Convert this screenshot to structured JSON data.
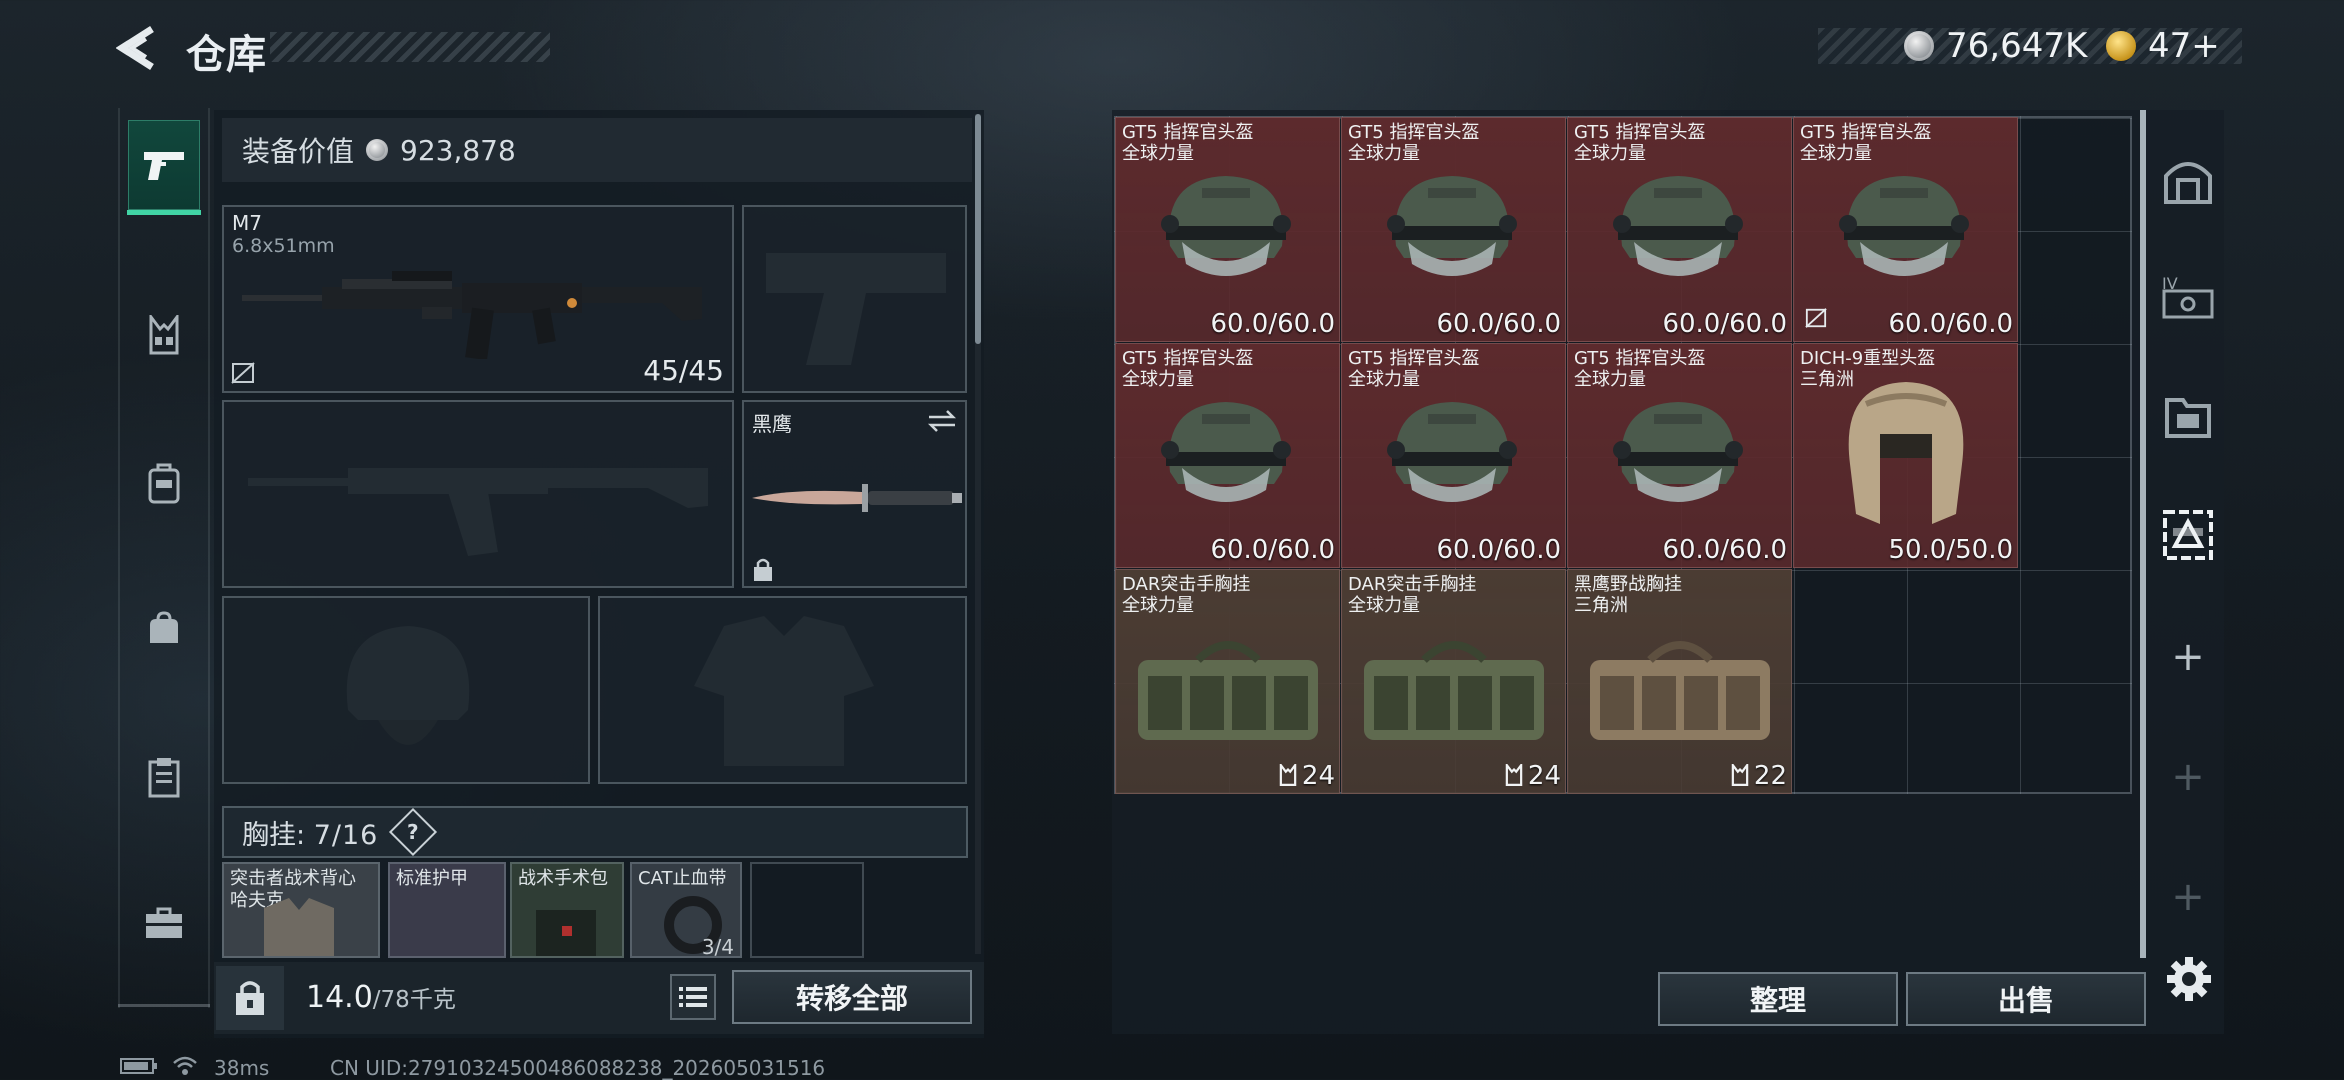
{
  "header": {
    "title": "仓库",
    "currencies": [
      {
        "icon": "silver-coin-icon",
        "value": "76,647K"
      },
      {
        "icon": "gold-coin-icon",
        "value": "47+"
      }
    ]
  },
  "rail_tabs": [
    {
      "name": "weapons",
      "icon": "pistol-icon",
      "active": true
    },
    {
      "name": "chest-rig",
      "icon": "chest-rig-icon",
      "active": false
    },
    {
      "name": "backpack",
      "icon": "backpack-icon",
      "active": false
    },
    {
      "name": "pouch",
      "icon": "pouch-icon",
      "active": false
    },
    {
      "name": "supplies",
      "icon": "clipboard-icon",
      "active": false
    },
    {
      "name": "case",
      "icon": "briefcase-icon",
      "active": false
    }
  ],
  "loadout": {
    "equipment_value_label": "装备价值",
    "equipment_value": "923,878",
    "primary": {
      "name": "M7",
      "caliber": "6.8x51mm",
      "ammo": "45/45"
    },
    "melee": {
      "name": "黑鹰"
    },
    "rig": {
      "label": "胸挂:",
      "count": "7/16",
      "help": "?"
    },
    "rig_items": [
      {
        "name": "突击者战术背心",
        "sub": "哈夫克"
      },
      {
        "name": "标准护甲",
        "sub": ""
      },
      {
        "name": "战术手术包",
        "sub": ""
      },
      {
        "name": "CAT止血带",
        "sub": ""
      }
    ],
    "rig_item_count": "3/4"
  },
  "footer_left": {
    "weight_value": "14.0",
    "weight_max": "/78千克",
    "transfer_all_label": "转移全部"
  },
  "stash": {
    "items": [
      {
        "name": "GT5 指挥官头盔",
        "sub": "全球力量",
        "value": "60.0/60.0",
        "color": "#5c2a2d",
        "kind": "helmet",
        "locked": false
      },
      {
        "name": "GT5 指挥官头盔",
        "sub": "全球力量",
        "value": "60.0/60.0",
        "color": "#5c2a2d",
        "kind": "helmet",
        "locked": false
      },
      {
        "name": "GT5 指挥官头盔",
        "sub": "全球力量",
        "value": "60.0/60.0",
        "color": "#5c2a2d",
        "kind": "helmet",
        "locked": false
      },
      {
        "name": "GT5 指挥官头盔",
        "sub": "全球力量",
        "value": "60.0/60.0",
        "color": "#5c2a2d",
        "kind": "helmet",
        "locked": true
      },
      {
        "name": "GT5 指挥官头盔",
        "sub": "全球力量",
        "value": "60.0/60.0",
        "color": "#5c2a2d",
        "kind": "helmet",
        "locked": false
      },
      {
        "name": "GT5 指挥官头盔",
        "sub": "全球力量",
        "value": "60.0/60.0",
        "color": "#5c2a2d",
        "kind": "helmet",
        "locked": false
      },
      {
        "name": "GT5 指挥官头盔",
        "sub": "全球力量",
        "value": "60.0/60.0",
        "color": "#5c2a2d",
        "kind": "helmet",
        "locked": false
      },
      {
        "name": "DICH-9重型头盔",
        "sub": "三角洲",
        "value": "50.0/50.0",
        "color": "#5c2a2d",
        "kind": "heavy-helmet",
        "locked": false
      },
      {
        "name": "DAR突击手胸挂",
        "sub": "全球力量",
        "value": "24",
        "color": "#4b3c33",
        "kind": "rig",
        "locked": false
      },
      {
        "name": "DAR突击手胸挂",
        "sub": "全球力量",
        "value": "24",
        "color": "#4b3c33",
        "kind": "rig",
        "locked": false
      },
      {
        "name": "黑鹰野战胸挂",
        "sub": "三角洲",
        "value": "22",
        "color": "#4b3c33",
        "kind": "rig-tan",
        "locked": false
      }
    ],
    "sort_label": "整理",
    "sell_label": "出售"
  },
  "side_tabs": [
    {
      "icon": "safe-box-icon"
    },
    {
      "icon": "level-case-icon"
    },
    {
      "icon": "folder-case-icon"
    },
    {
      "icon": "stash-grid-icon",
      "active": true
    },
    {
      "icon": "add-icon"
    },
    {
      "icon": "add-icon"
    },
    {
      "icon": "add-icon"
    }
  ],
  "status_bar": {
    "ping": "38ms",
    "uid": "CN UID:27910324500486088238_202605031516"
  }
}
